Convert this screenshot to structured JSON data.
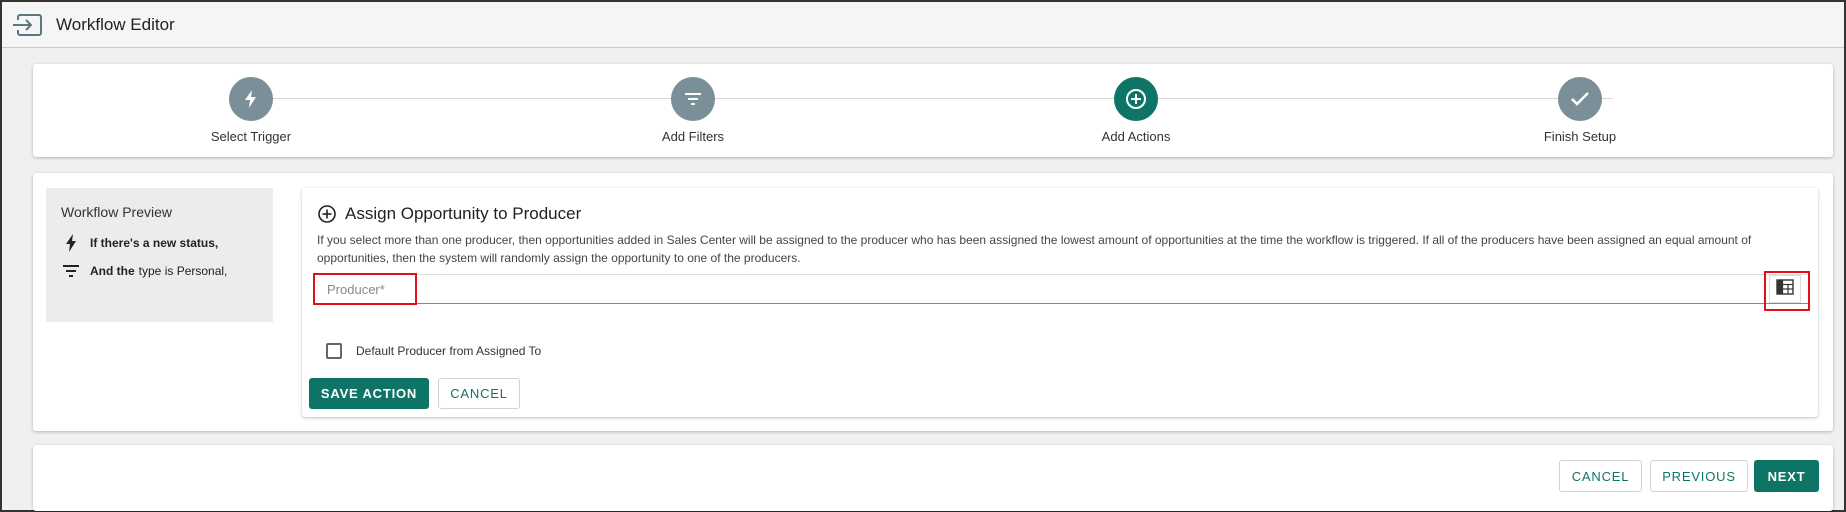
{
  "window": {
    "title": "Workflow Editor",
    "exit_icon": "exit-to-app-icon"
  },
  "stepper": {
    "steps": [
      {
        "label": "Select Trigger",
        "icon": "lightning-bolt-icon",
        "state": "inactive"
      },
      {
        "label": "Add Filters",
        "icon": "filter-icon",
        "state": "inactive"
      },
      {
        "label": "Add Actions",
        "icon": "plus-circle-icon",
        "state": "active"
      },
      {
        "label": "Finish Setup",
        "icon": "check-icon",
        "state": "inactive"
      }
    ],
    "colors": {
      "active": "#0e7566",
      "inactive": "#7b8f99"
    }
  },
  "preview": {
    "heading": "Workflow Preview",
    "trigger": {
      "bold": "If there's a new status,",
      "rest": ""
    },
    "filter": {
      "bold": "And the",
      "rest": "type is Personal,"
    }
  },
  "action": {
    "title": "Assign Opportunity to Producer",
    "description": "If you select more than one producer, then opportunities added in Sales Center will be assigned to the producer who has been assigned the lowest amount of opportunities at the time the workflow is triggered. If all of the producers have been assigned an equal amount of opportunities, then the system will randomly assign the opportunity to one of the producers.",
    "producer_field": {
      "placeholder": "Producer*",
      "value": ""
    },
    "default_checkbox": {
      "label": "Default Producer from Assigned To",
      "checked": false
    },
    "save_label": "SAVE ACTION",
    "cancel_label": "CANCEL"
  },
  "footer": {
    "cancel_label": "CANCEL",
    "previous_label": "PREVIOUS",
    "next_label": "NEXT"
  },
  "theme": {
    "primary": "#0e7566",
    "highlight": "#e0101a"
  }
}
